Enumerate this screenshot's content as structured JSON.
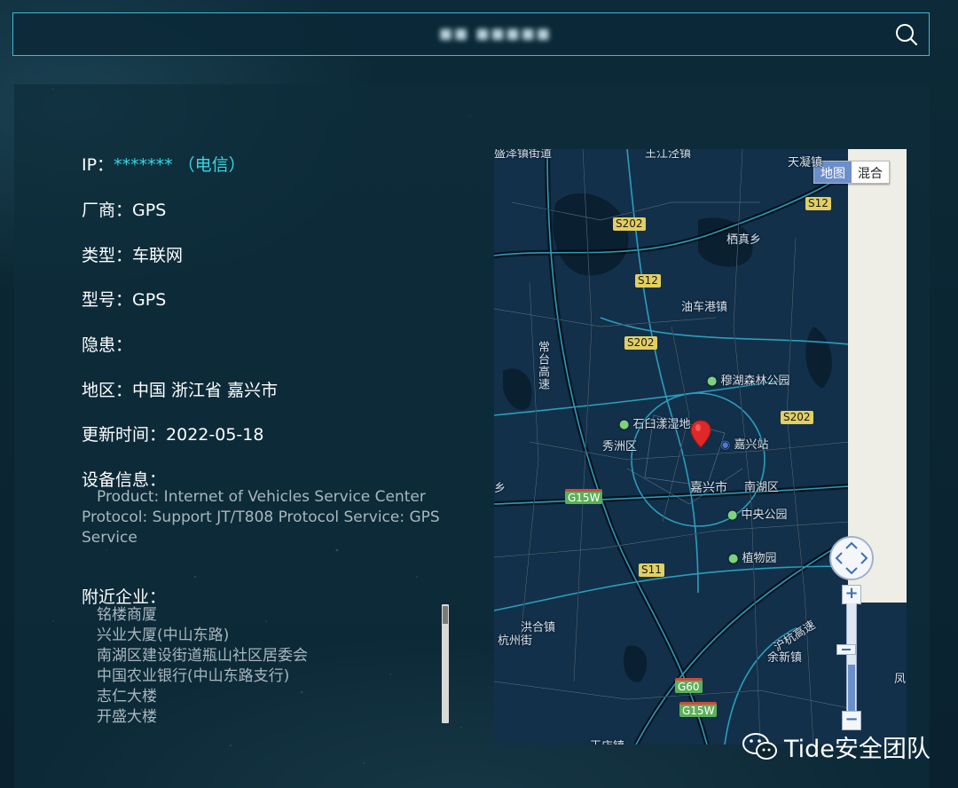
{
  "search": {
    "query": "■■ ■■■■■"
  },
  "info": {
    "ip_label": "IP：",
    "ip_value": "******* （电信）",
    "vendor_label": "厂商：",
    "vendor_value": "GPS",
    "type_label": "类型：",
    "type_value": "车联网",
    "model_label": "型号：",
    "model_value": "GPS",
    "risk_label": "隐患：",
    "risk_value": "",
    "region_label": "地区：",
    "region_value": "中国 浙江省 嘉兴市",
    "updated_label": "更新时间：",
    "updated_value": "2022-05-18",
    "device_label": "设备信息：",
    "device_text": "Product: Internet of Vehicles Service Center Protocol: Support JT/T808 Protocol Service: GPS Service",
    "nearby_label": "附近企业："
  },
  "nearby_companies": [
    "铭楼商厦",
    "兴业大厦(中山东路)",
    "南湖区建设街道瓶山社区居委会",
    "中国农业银行(中山东路支行)",
    "志仁大楼",
    "开盛大楼"
  ],
  "map": {
    "type_buttons": {
      "map": "地图",
      "hybrid": "混合"
    },
    "active_type": "地图",
    "labels": {
      "top_left": "盛泽镇街道",
      "top_mid": "王江泾镇",
      "tianning": "天凝镇",
      "xinzhen": "栖真乡",
      "youche": "油车港镇",
      "muhu": "穆湖森林公园",
      "shibai": "石臼漾湿地",
      "xiuzhou": "秀洲区",
      "station": "嘉兴站",
      "jiaxing": "嘉兴市",
      "nanhu": "南湖区",
      "zhongyang": "中央公园",
      "zhiwu": "植物园",
      "hongzhou": "洪合镇",
      "hangzhou_jie": "杭州街",
      "yuxin": "余新镇",
      "huhang": "沪杭高速",
      "changtai": "常台高速",
      "feng": "凤",
      "xiang": "乡",
      "bottom": "王店镇"
    },
    "shields": {
      "s202_a": "S202",
      "s12_a": "S12",
      "s12_b": "S12",
      "s202_b": "S202",
      "s202_c": "S202",
      "g15w_a": "G15W",
      "s11": "S11",
      "g60": "G60",
      "g15w_b": "G15W"
    },
    "zoom_level_fraction": 0.45
  },
  "watermark": {
    "text": "Tide安全团队"
  },
  "colors": {
    "accent": "#39d6e4",
    "border": "#3fb8d4",
    "marker": "#e02828"
  }
}
